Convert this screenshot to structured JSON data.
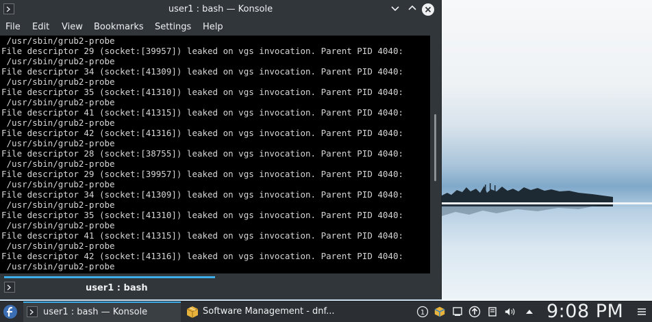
{
  "window": {
    "title": "user1 : bash — Konsole",
    "controls": {
      "minimize": "⌄",
      "maximize": "⌃",
      "close": "✕"
    }
  },
  "menubar": {
    "items": [
      "File",
      "Edit",
      "View",
      "Bookmarks",
      "Settings",
      "Help"
    ]
  },
  "terminal": {
    "lines": [
      " /usr/sbin/grub2-probe",
      "File descriptor 29 (socket:[39957]) leaked on vgs invocation. Parent PID 4040:",
      " /usr/sbin/grub2-probe",
      "File descriptor 34 (socket:[41309]) leaked on vgs invocation. Parent PID 4040:",
      " /usr/sbin/grub2-probe",
      "File descriptor 35 (socket:[41310]) leaked on vgs invocation. Parent PID 4040:",
      " /usr/sbin/grub2-probe",
      "File descriptor 41 (socket:[41315]) leaked on vgs invocation. Parent PID 4040:",
      " /usr/sbin/grub2-probe",
      "File descriptor 42 (socket:[41316]) leaked on vgs invocation. Parent PID 4040:",
      " /usr/sbin/grub2-probe",
      "File descriptor 28 (socket:[38755]) leaked on vgs invocation. Parent PID 4040:",
      " /usr/sbin/grub2-probe",
      "File descriptor 29 (socket:[39957]) leaked on vgs invocation. Parent PID 4040:",
      " /usr/sbin/grub2-probe",
      "File descriptor 34 (socket:[41309]) leaked on vgs invocation. Parent PID 4040:",
      " /usr/sbin/grub2-probe",
      "File descriptor 35 (socket:[41310]) leaked on vgs invocation. Parent PID 4040:",
      " /usr/sbin/grub2-probe",
      "File descriptor 41 (socket:[41315]) leaked on vgs invocation. Parent PID 4040:",
      " /usr/sbin/grub2-probe",
      "File descriptor 42 (socket:[41316]) leaked on vgs invocation. Parent PID 4040:",
      " /usr/sbin/grub2-probe"
    ]
  },
  "tabbar": {
    "tab_label": "user1 : bash"
  },
  "taskbar": {
    "tasks": [
      {
        "label": "user1 : bash — Konsole",
        "icon": "terminal-icon"
      },
      {
        "label": "Software Management - dnf...",
        "icon": "package-icon"
      }
    ],
    "tray_icons": [
      "notifications-icon",
      "package-updates-icon",
      "clipboard-icon",
      "network-icon",
      "update-icon",
      "device-notifier-icon",
      "volume-icon",
      "expand-tray-icon"
    ],
    "clock": "9:08 PM"
  },
  "colors": {
    "window_bg": "#31363b",
    "terminal_bg": "#000000",
    "terminal_fg": "#d6d6d6",
    "accent": "#3daee9",
    "panel_bg": "#2b2f33"
  }
}
